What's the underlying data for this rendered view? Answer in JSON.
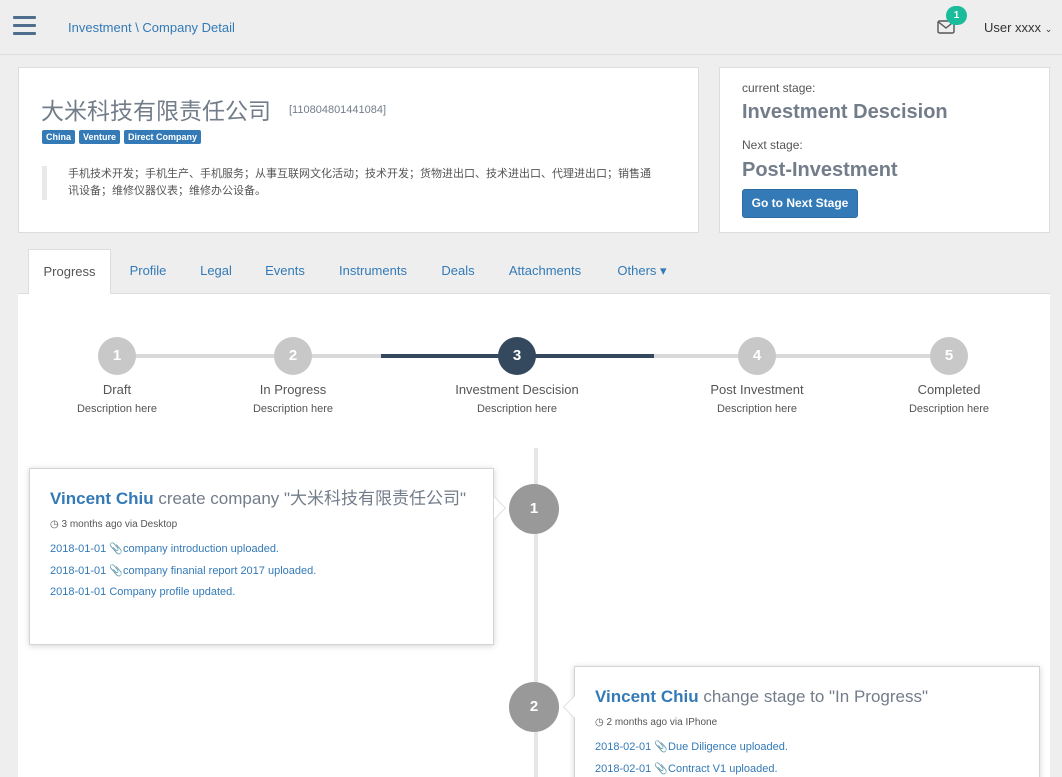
{
  "topbar": {
    "breadcrumb": "Investment \\ Company Detail",
    "notification_count": "1",
    "user_label": "User xxxx"
  },
  "company": {
    "name": "大米科技有限责任公司",
    "id": "[110804801441084]",
    "tags": [
      "China",
      "Venture",
      "Direct Company"
    ],
    "description": "手机技术开发；手机生产、手机服务；从事互联网文化活动；技术开发；货物进出口、技术进出口、代理进出口；销售通讯设备；维修仪器仪表；维修办公设备。"
  },
  "stage": {
    "current_label": "current stage:",
    "current_value": "Investment Descision",
    "next_label": "Next stage:",
    "next_value": "Post-Investment",
    "button_label": "Go to Next Stage"
  },
  "tabs": [
    "Progress",
    "Profile",
    "Legal",
    "Events",
    "Instruments",
    "Deals",
    "Attachments",
    "Others ▾"
  ],
  "steps": [
    {
      "num": "1",
      "title": "Draft",
      "desc": "Description here"
    },
    {
      "num": "2",
      "title": "In Progress",
      "desc": "Description here"
    },
    {
      "num": "3",
      "title": "Investment Descision",
      "desc": "Description here"
    },
    {
      "num": "4",
      "title": "Post Investment",
      "desc": "Description here"
    },
    {
      "num": "5",
      "title": "Completed",
      "desc": "Description here"
    }
  ],
  "timeline": [
    {
      "num": "1",
      "who": "Vincent Chiu",
      "action": " create company \"大米科技有限责任公司\"",
      "meta": "3 months ago via Desktop",
      "events": [
        {
          "date": "2018-01-01",
          "clip": true,
          "text": "company introduction",
          "suffix": " uploaded."
        },
        {
          "date": "2018-01-01",
          "clip": true,
          "text": "company finanial report 2017",
          "suffix": " uploaded."
        },
        {
          "date": "2018-01-01",
          "clip": false,
          "text": "Company profile",
          "suffix": " updated."
        }
      ]
    },
    {
      "num": "2",
      "who": "Vincent Chiu",
      "action": " change stage to \"In Progress\"",
      "meta": "2 months ago via IPhone",
      "events": [
        {
          "date": "2018-02-01",
          "clip": true,
          "text": "Due Diligence",
          "suffix": " uploaded."
        },
        {
          "date": "2018-02-01",
          "clip": true,
          "text": "Contract V1",
          "suffix": " uploaded."
        }
      ]
    }
  ]
}
